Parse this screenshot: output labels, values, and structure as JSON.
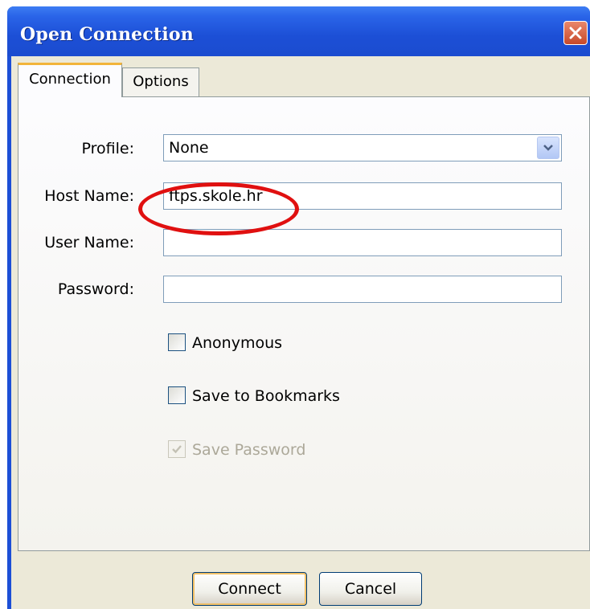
{
  "window": {
    "title": "Open Connection"
  },
  "tabs": {
    "connection_label": "Connection",
    "options_label": "Options"
  },
  "form": {
    "profile_label": "Profile:",
    "profile_value": "None",
    "host_label": "Host Name:",
    "host_value": "ftps.skole.hr",
    "user_label": "User Name:",
    "user_value": "",
    "password_label": "Password:",
    "password_value": ""
  },
  "checkboxes": {
    "anonymous_label": "Anonymous",
    "anonymous_checked": false,
    "bookmarks_label": "Save to Bookmarks",
    "bookmarks_checked": false,
    "save_password_label": "Save Password",
    "save_password_checked": true,
    "save_password_enabled": false
  },
  "buttons": {
    "connect_label": "Connect",
    "cancel_label": "Cancel"
  },
  "colors": {
    "titlebar": "#1c4fd6",
    "dialog_bg": "#ece9d8",
    "highlight_ring": "#e01010",
    "close_button": "#c7492a"
  },
  "icons": {
    "close": "close-icon",
    "dropdown": "chevron-down-icon",
    "check": "checkmark-icon"
  }
}
